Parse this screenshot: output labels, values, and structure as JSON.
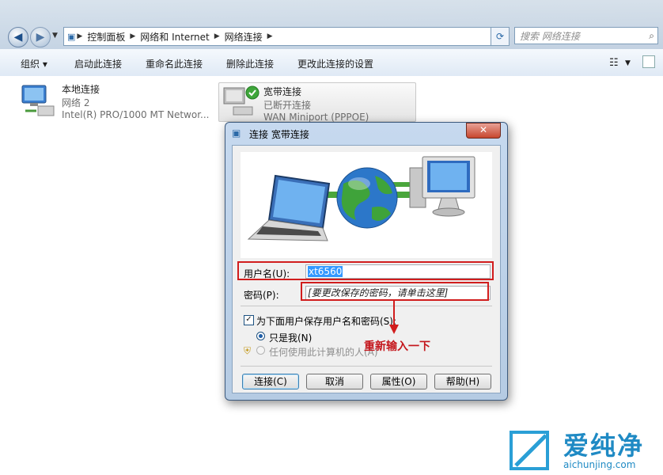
{
  "explorer": {
    "breadcrumbs": [
      "控制面板",
      "网络和 Internet",
      "网络连接"
    ],
    "search_placeholder": "搜索 网络连接",
    "toolbar": [
      "组织 ▾",
      "启动此连接",
      "重命名此连接",
      "删除此连接",
      "更改此连接的设置"
    ]
  },
  "connections": [
    {
      "name": "本地连接",
      "line2": "网络  2",
      "line3": "Intel(R) PRO/1000 MT Networ..."
    },
    {
      "name": "宽带连接",
      "line2": "已断开连接",
      "line3": "WAN Miniport (PPPOE)"
    }
  ],
  "dialog": {
    "title": "连接 宽带连接",
    "close": "✕",
    "username_label": "用户名(U):",
    "username_value": "xt6560",
    "password_label": "密码(P):",
    "password_hint": "[要更改保存的密码，请单击这里]",
    "save_checkbox": "为下面用户保存用户名和密码(S):",
    "radio_me": "只是我(N)",
    "radio_anyone": "任何使用此计算机的人(A)",
    "buttons": [
      "连接(C)",
      "取消",
      "属性(O)",
      "帮助(H)"
    ]
  },
  "annotation": "重新输入一下",
  "watermark": {
    "brand": "爱纯净",
    "url": "aichunjing.com"
  },
  "colors": {
    "highlight": "#d11d1d",
    "accent": "#1e5ea8"
  }
}
